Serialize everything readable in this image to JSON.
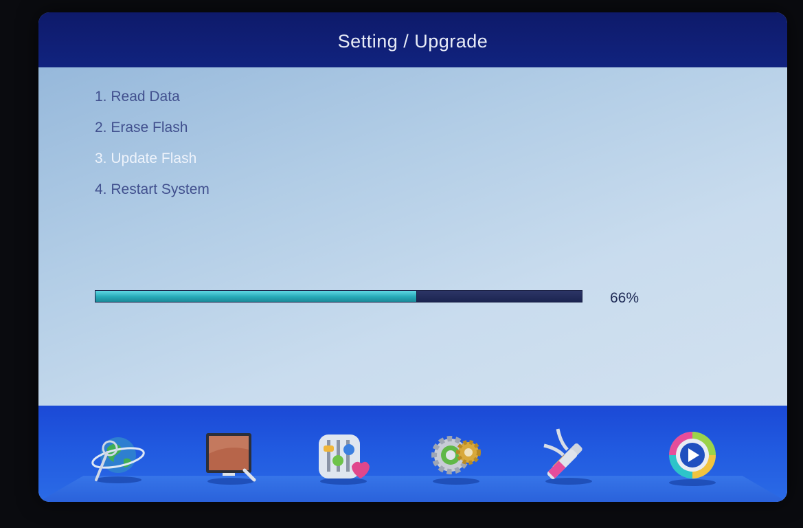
{
  "header": {
    "title": "Setting / Upgrade"
  },
  "steps": [
    {
      "label": "1. Read Data",
      "active": false
    },
    {
      "label": "2. Erase Flash",
      "active": false
    },
    {
      "label": "3. Update Flash",
      "active": true
    },
    {
      "label": "4. Restart System",
      "active": false
    }
  ],
  "progress": {
    "value": 0.66,
    "label": "66%"
  },
  "dock": {
    "items": [
      {
        "icon": "globe-icon"
      },
      {
        "icon": "monitor-icon"
      },
      {
        "icon": "equalizer-icon"
      },
      {
        "icon": "gear-icon"
      },
      {
        "icon": "av-cable-icon"
      },
      {
        "icon": "play-icon"
      }
    ]
  },
  "colors": {
    "header_bg": "#11237f",
    "active_step": "#eef3fb",
    "inactive_step": "#41508e",
    "progress_fill": "#26aab8",
    "dock_bg": "#215ae0"
  }
}
